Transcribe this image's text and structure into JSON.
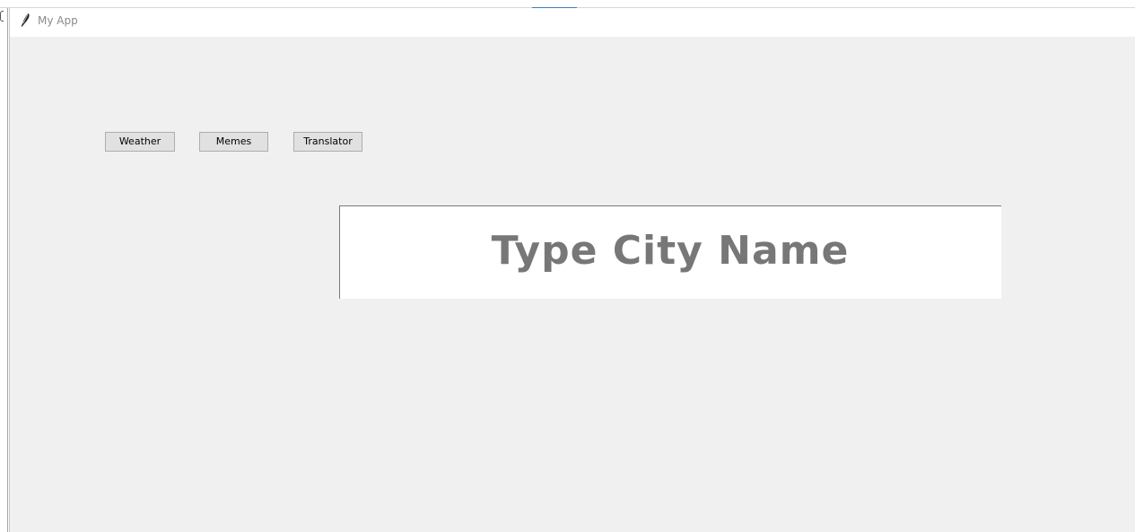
{
  "window": {
    "title": "My App",
    "icon": "feather-icon"
  },
  "nav": {
    "buttons": [
      {
        "label": "Weather"
      },
      {
        "label": "Memes"
      },
      {
        "label": "Translator"
      }
    ]
  },
  "city_entry": {
    "value": "Type City Name"
  },
  "colors": {
    "client_bg": "#f0f0f0",
    "button_bg": "#e1e1e1",
    "entry_text": "#777777",
    "title_text": "#8a8a8a"
  }
}
